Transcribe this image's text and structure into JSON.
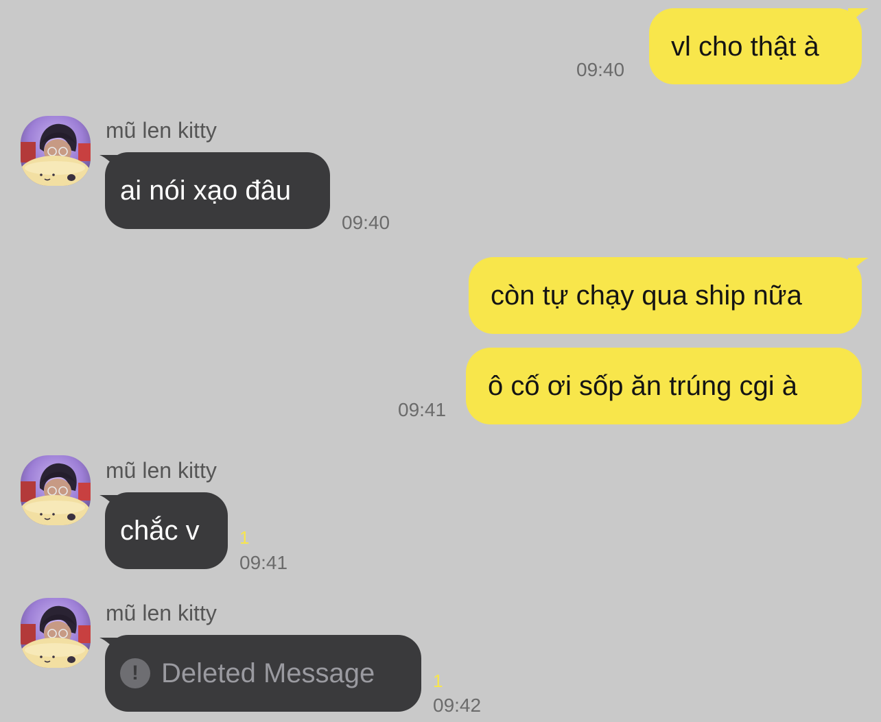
{
  "messages": [
    {
      "from": "me",
      "text": "vl cho thật à",
      "time": "09:40"
    },
    {
      "from": "them",
      "sender": "mũ len kitty",
      "text": "ai nói xạo đâu",
      "time": "09:40"
    },
    {
      "from": "me",
      "text": "còn tự chạy qua ship nữa"
    },
    {
      "from": "me",
      "text": "ô cố ơi sốp ăn trúng cgi à",
      "time": "09:41"
    },
    {
      "from": "them",
      "sender": "mũ len kitty",
      "text": "chắc v",
      "unread": "1",
      "time": "09:41"
    },
    {
      "from": "them",
      "sender": "mũ len kitty",
      "text": "Deleted Message",
      "deleted": true,
      "unread": "1",
      "time": "09:42"
    }
  ],
  "colors": {
    "background": "#c9c9c9",
    "my_bubble": "#f8e64b",
    "their_bubble": "#3a3a3c",
    "unread": "#f8e64b"
  },
  "icons": {
    "avatar": "profile-photo",
    "deleted": "exclamation-circle-icon"
  }
}
